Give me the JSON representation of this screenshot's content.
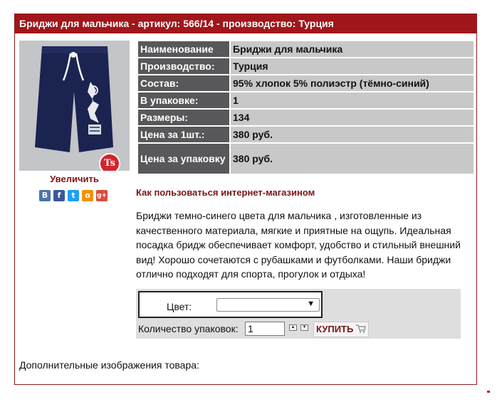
{
  "product": {
    "title": "Бриджи для мальчика - артикул: 566/14 - производство: Турция",
    "enlarge_label": "Увеличить",
    "brand_badge": "Ts"
  },
  "social": [
    {
      "icon": "vk-icon",
      "glyph": "В",
      "color": "#4a76a8"
    },
    {
      "icon": "facebook-icon",
      "glyph": "f",
      "color": "#3b5998"
    },
    {
      "icon": "twitter-icon",
      "glyph": "t",
      "color": "#1da1f2"
    },
    {
      "icon": "odnoklassniki-icon",
      "glyph": "o",
      "color": "#f39200"
    },
    {
      "icon": "google-plus-icon",
      "glyph": "g+",
      "color": "#dd4b39"
    }
  ],
  "specs": [
    {
      "label": "Наименование",
      "value": "Бриджи для мальчика"
    },
    {
      "label": "Производство:",
      "value": "Турция"
    },
    {
      "label": "Состав:",
      "value": "95% хлопок 5% полиэстр (тёмно-синий)"
    },
    {
      "label": "В упаковке:",
      "value": "1"
    },
    {
      "label": "Размеры:",
      "value": "134"
    },
    {
      "label": "Цена за 1шт.:",
      "value": "380 руб."
    },
    {
      "label": "Цена за упаковку",
      "value": "380 руб."
    }
  ],
  "howto_link": "Как пользоваться интернет-магазином",
  "description_lines": [
    "Бриджи темно-синего цвета  для мальчика , изготовленные из",
    "качественного материала, мягкие и приятные на ощупь.  Идеальная",
    "посадка бридж обеспечивает комфорт, удобство и стильный внешний",
    "вид!  Хорошо сочетаются с рубашками и футболками.  Наши  бриджи",
    "отлично  подходят для спорта, прогулок и отдыха!"
  ],
  "order": {
    "color_label": "Цвет:",
    "color_value": "",
    "qty_label": "Количество упаковок:",
    "qty_value": "1",
    "buy_label": "КУПИТЬ"
  },
  "more_images_label": "Дополнительные изображения товара:",
  "colors": {
    "title_bar": "#a0161a",
    "spec_key": "#58585a",
    "spec_value": "#c8c8c8",
    "link": "#7a1414"
  }
}
